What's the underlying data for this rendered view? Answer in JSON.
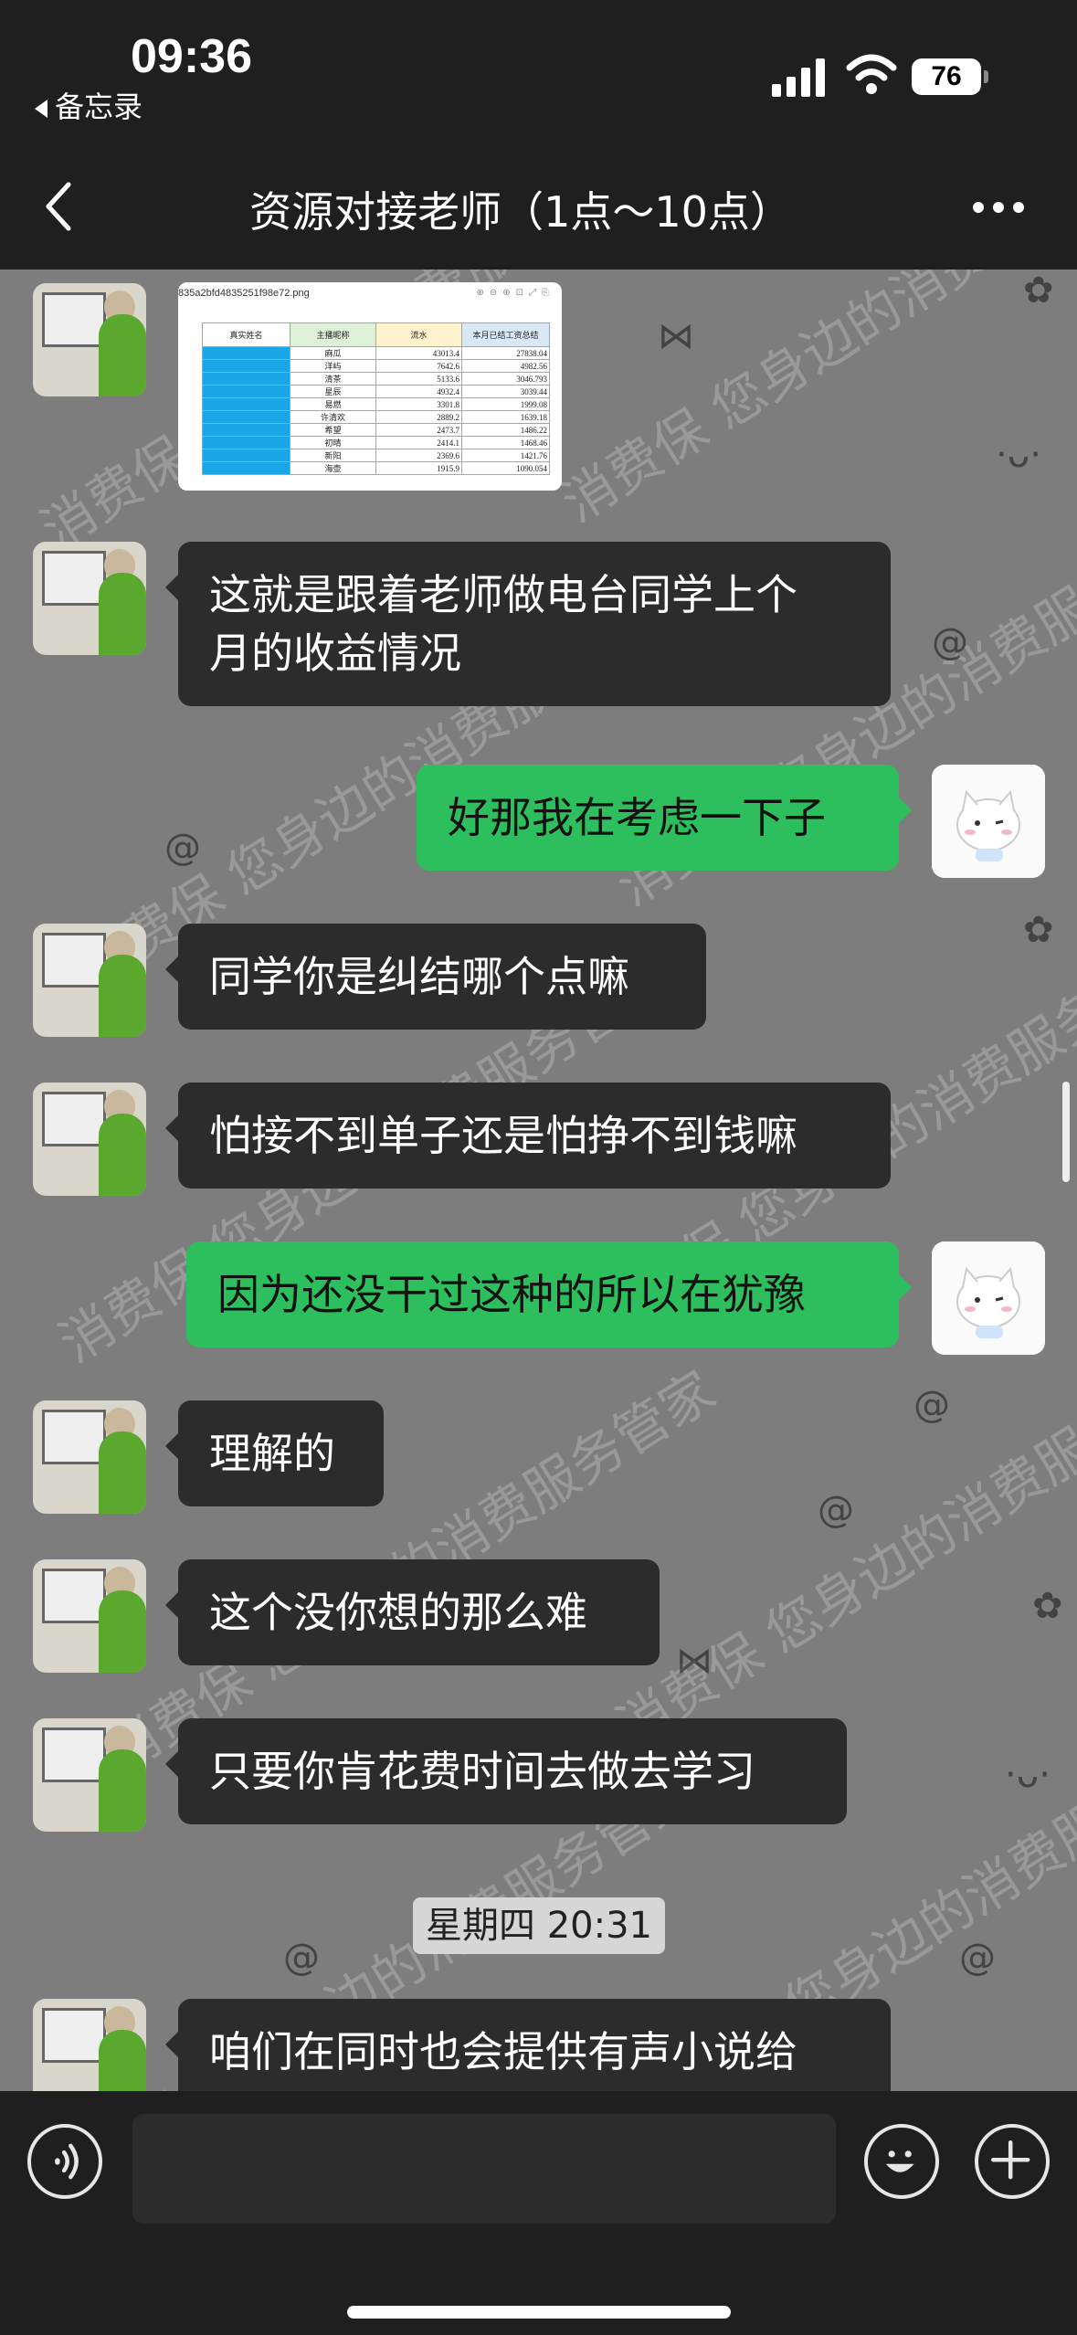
{
  "status_bar": {
    "time": "09:36",
    "back_app": "备忘录",
    "battery": "76"
  },
  "header": {
    "title": "资源对接老师（1点～10点）",
    "back_icon": "chevron-left-icon",
    "more_icon": "ellipsis-icon"
  },
  "image_message": {
    "filename": "835a2bfd4835251f98e72.png",
    "columns": [
      "真实姓名",
      "主播昵称",
      "流水",
      "本月已结工资总结"
    ],
    "rows": [
      [
        "",
        "麻瓜",
        "43013.4",
        "27838.04"
      ],
      [
        "",
        "洋屿",
        "7642.6",
        "4982.56"
      ],
      [
        "",
        "清茶",
        "5133.6",
        "3046.793"
      ],
      [
        "",
        "星辰",
        "4932.4",
        "3039.44"
      ],
      [
        "",
        "易燃",
        "3301.8",
        "1999.08"
      ],
      [
        "",
        "许清欢",
        "2889.2",
        "1639.18"
      ],
      [
        "",
        "希望",
        "2473.7",
        "1486.22"
      ],
      [
        "",
        "初晴",
        "2414.1",
        "1468.46"
      ],
      [
        "",
        "新阳",
        "2369.6",
        "1421.76"
      ],
      [
        "",
        "海壶",
        "1915.9",
        "1090.054"
      ]
    ]
  },
  "messages": [
    {
      "side": "left",
      "text_lines": [
        "这就是跟着老师做电台同学上个",
        "月的收益情况"
      ]
    },
    {
      "side": "right",
      "text_lines": [
        "好那我在考虑一下子"
      ]
    },
    {
      "side": "left",
      "text_lines": [
        "同学你是纠结哪个点嘛"
      ]
    },
    {
      "side": "left",
      "text_lines": [
        "怕接不到单子还是怕挣不到钱嘛"
      ]
    },
    {
      "side": "right",
      "text_lines": [
        "因为还没干过这种的所以在犹豫"
      ]
    },
    {
      "side": "left",
      "text_lines": [
        "理解的"
      ]
    },
    {
      "side": "left",
      "text_lines": [
        "这个没你想的那么难"
      ]
    },
    {
      "side": "left",
      "text_lines": [
        "只要你肯花费时间去做去学习"
      ]
    },
    {
      "side": "left",
      "text_lines": [
        "咱们在同时也会提供有声小说给"
      ]
    }
  ],
  "timestamp": "星期四 20:31",
  "watermark": "消费保 您身边的消费服务管家",
  "input_bar": {
    "voice_icon": "voice-icon",
    "emoji_icon": "emoji-icon",
    "plus_icon": "plus-icon"
  }
}
